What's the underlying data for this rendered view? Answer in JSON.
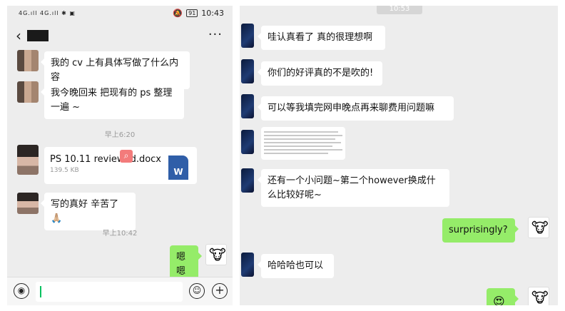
{
  "left": {
    "status": {
      "signal": "4G.ıll 4G.ıll ✱ ▣",
      "battery": "91",
      "time": "10:43"
    },
    "header": {
      "back": "‹",
      "more": "···"
    },
    "messages": [
      {
        "text": "我的 cv 上有具体写做了什么内容"
      },
      {
        "text": "我今晚回来 把现有的 ps 整理一遍 ~"
      }
    ],
    "time1": "早上6:20",
    "file": {
      "name": "PS 10.11 reviewed.docx",
      "size": "139.5 KB",
      "icon_label": "W"
    },
    "reply": "写的真好 辛苦了🙏🏼",
    "time2": "早上10:42",
    "my_reply": "嗯嗯",
    "input": {
      "voice": "◉",
      "emoji": "☺",
      "plus": "+"
    }
  },
  "right": {
    "top_time": "10:53",
    "messages": [
      "哇认真看了 真的很理想啊",
      "你们的好评真的不是吹的!",
      "可以等我填完网申晚点再来聊费用问题嘛",
      "还有一个小问题~第二个however换成什么比较好呢~",
      "哈哈哈也可以"
    ],
    "me": [
      "surprisingly?",
      "😍"
    ]
  },
  "colors": {
    "bg": "#ededed",
    "me_bubble": "#95ec69",
    "accent": "#07c160",
    "word": "#2f5ea8"
  }
}
